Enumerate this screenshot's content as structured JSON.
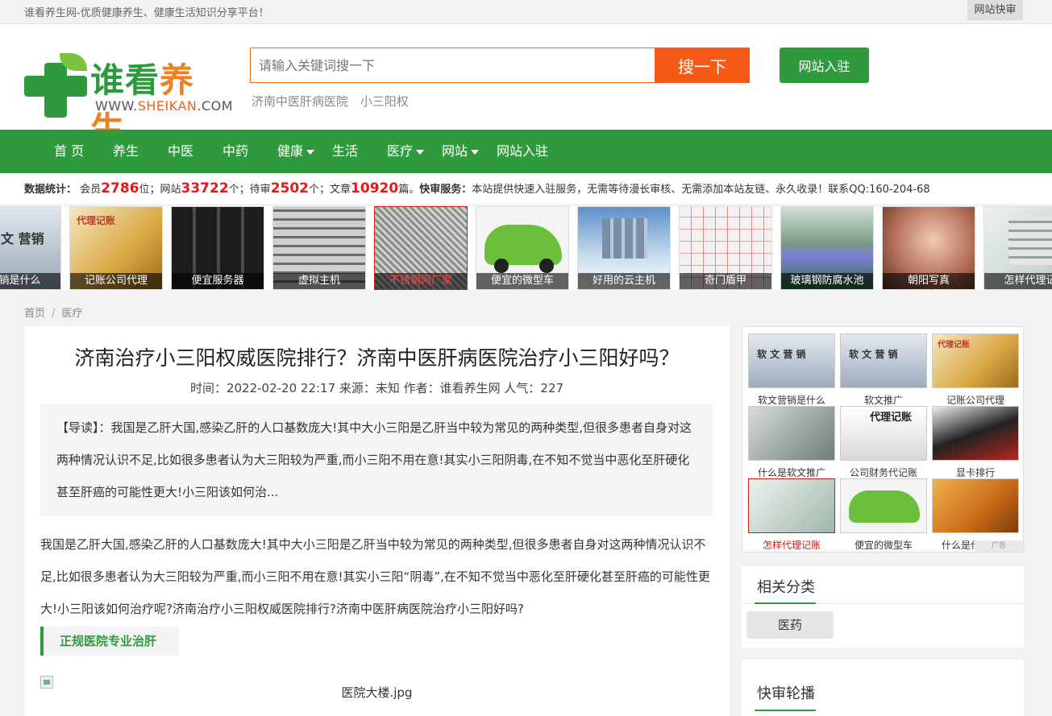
{
  "topbar": {
    "slogan": "谁看养生网-优质健康养生、健康生活知识分享平台！",
    "quick_link": "网站快审"
  },
  "logo": {
    "brand_a": "谁看",
    "brand_b": "养生",
    "url_pre": "WWW.",
    "url_mid": "SHEIKAN",
    "url_post": ".COM"
  },
  "search": {
    "placeholder": "请输入关键词搜一下",
    "button": "搜一下",
    "join": "网站入驻",
    "hotwords": [
      "济南中医肝病医院",
      "小三阳权"
    ]
  },
  "nav": [
    {
      "label": "首 页",
      "dropdown": false
    },
    {
      "label": "养生",
      "dropdown": false
    },
    {
      "label": "中医",
      "dropdown": false
    },
    {
      "label": "中药",
      "dropdown": false
    },
    {
      "label": "健康",
      "dropdown": true
    },
    {
      "label": "生活",
      "dropdown": false
    },
    {
      "label": "医疗",
      "dropdown": true
    },
    {
      "label": "网站",
      "dropdown": true
    },
    {
      "label": "网站入驻",
      "dropdown": false
    }
  ],
  "stats": {
    "label": "数据统计：",
    "members_pre": "会员",
    "members": "2786",
    "members_post": "位；网站",
    "sites": "33722",
    "sites_post": "个；待审",
    "pending": "2502",
    "pending_post": "个；文章",
    "articles": "10920",
    "articles_post": "篇。",
    "fast_label": "快审服务：",
    "fast_text": "本站提供快速入驻服务，无需等待漫长审核、无需添加本站友链、永久收录！联系QQ:160-204-68"
  },
  "strip": [
    {
      "caption": "营销是什么"
    },
    {
      "caption": "记账公司代理"
    },
    {
      "caption": "便宜服务器"
    },
    {
      "caption": "虚拟主机"
    },
    {
      "caption": "不锈钢网厂家"
    },
    {
      "caption": "便宜的微型车"
    },
    {
      "caption": "好用的云主机"
    },
    {
      "caption": "奇门盾甲"
    },
    {
      "caption": "玻璃钢防腐水池"
    },
    {
      "caption": "朝阳写真"
    },
    {
      "caption": "怎样代理记"
    }
  ],
  "strip_art_text": {
    "book": "文   营销",
    "acct": "代理记账"
  },
  "breadcrumb": {
    "home": "首页",
    "sep": "/",
    "current": "医疗"
  },
  "article": {
    "title": "济南治疗小三阳权威医院排行？济南中医肝病医院治疗小三阳好吗？",
    "meta": "时间：2022-02-20 22:17 来源：未知 作者：谁看养生网 人气：227",
    "intro": "【导读】：我国是乙肝大国,感染乙肝的人口基数庞大!其中大小三阳是乙肝当中较为常见的两种类型,但很多患者自身对这两种情况认识不足,比如很多患者认为大三阳较为严重,而小三阳不用在意!其实小三阳阴毒,在不知不觉当中恶化至肝硬化甚至肝癌的可能性更大!小三阳该如何治...",
    "body": "我国是乙肝大国,感染乙肝的人口基数庞大!其中大小三阳是乙肝当中较为常见的两种类型,但很多患者自身对这两种情况认识不足,比如很多患者认为大三阳较为严重,而小三阳不用在意!其实小三阳“阴毒”,在不知不觉当中恶化至肝硬化甚至肝癌的可能性更大!小三阳该如何治疗呢?济南治疗小三阳权威医院排行?济南中医肝病医院治疗小三阳好吗?",
    "subhead": "正规医院专业治肝",
    "image_alt": "医院大楼.jpg"
  },
  "side_ads": [
    {
      "label": "软文营销是什么",
      "art": "软 文    营 销"
    },
    {
      "label": "软文推广",
      "art": "软 文    营 销"
    },
    {
      "label": "记账公司代理",
      "art": "代理记账"
    },
    {
      "label": "什么是软文推广",
      "art": ""
    },
    {
      "label": "公司财务代记账",
      "art": "代理记账"
    },
    {
      "label": "显卡排行",
      "art": ""
    },
    {
      "label": "怎样代理记账",
      "art": ""
    },
    {
      "label": "便宜的微型车",
      "art": ""
    },
    {
      "label": "什么是代理记账",
      "art": ""
    }
  ],
  "side_ads_tag": "广告",
  "related": {
    "title": "相关分类",
    "tag": "医药"
  },
  "carousel": {
    "title": "快审轮播"
  }
}
